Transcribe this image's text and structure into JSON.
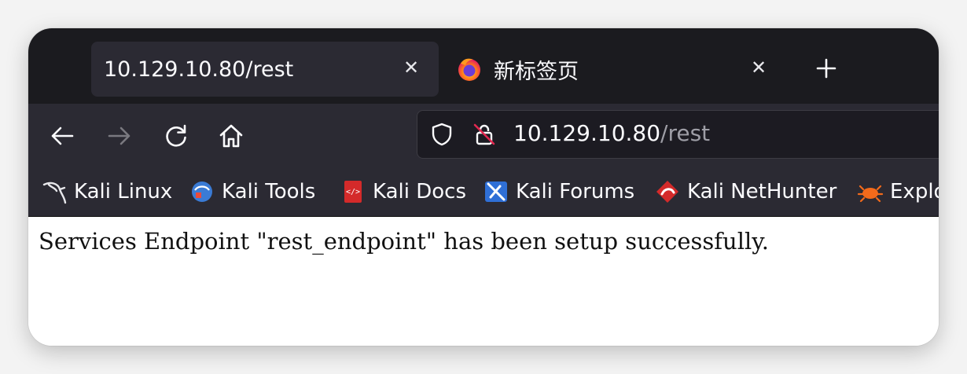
{
  "tabs": [
    {
      "title": "10.129.10.80/rest",
      "active": true
    },
    {
      "title": "新标签页",
      "active": false
    }
  ],
  "toolbar": {
    "back_icon": "arrow-left-icon",
    "forward_icon": "arrow-right-icon",
    "reload_icon": "reload-icon",
    "home_icon": "home-icon"
  },
  "address_bar": {
    "host": "10.129.10.80",
    "path": "/rest"
  },
  "bookmarks": [
    {
      "label": "Kali Linux",
      "icon": "kali-dragon-icon"
    },
    {
      "label": "Kali Tools",
      "icon": "kali-tools-icon"
    },
    {
      "label": "Kali Docs",
      "icon": "kali-docs-icon"
    },
    {
      "label": "Kali Forums",
      "icon": "kali-forums-icon"
    },
    {
      "label": "Kali NetHunter",
      "icon": "kali-nethunter-icon"
    },
    {
      "label": "Explo",
      "icon": "exploit-db-icon"
    }
  ],
  "page": {
    "message": "Services Endpoint \"rest_endpoint\" has been setup successfully."
  },
  "colors": {
    "tabbar_bg": "#1b1b1f",
    "toolbar_bg": "#2b2a33",
    "urlbar_bg": "#1c1b22",
    "text_light": "#fbfbfe",
    "path_gray": "#9e9ea6"
  }
}
